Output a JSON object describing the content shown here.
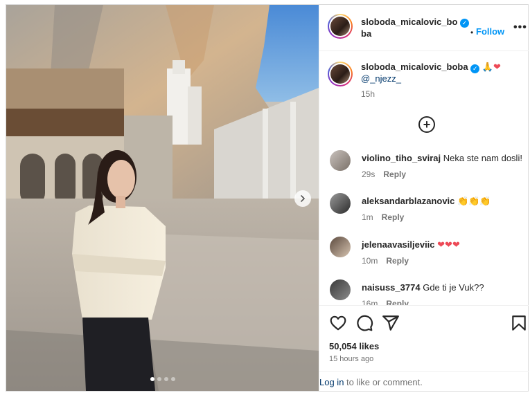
{
  "post": {
    "author": "sloboda_micalovic_boba",
    "follow_label": "Follow",
    "separator": "•",
    "more_label": "•••",
    "caption": {
      "username": "sloboda_micalovic_boba",
      "emojis": "🙏❤",
      "mention": "@_njezz_",
      "time": "15h"
    },
    "load_more_label": "+"
  },
  "photo": {
    "slide_count": 4,
    "active_slide": 1
  },
  "comments": [
    {
      "username": "violino_tiho_sviraj",
      "text": "Neka ste nam dosli!",
      "time": "29s",
      "reply_label": "Reply"
    },
    {
      "username": "aleksandarblazanovic",
      "text": "👏👏👏",
      "time": "1m",
      "reply_label": "Reply"
    },
    {
      "username": "jelenaavasiljeviic",
      "text": "❤❤❤",
      "time": "10m",
      "reply_label": "Reply"
    },
    {
      "username": "naisuss_3774",
      "text": "Gde ti je Vuk??",
      "time": "16m",
      "reply_label": "Reply"
    }
  ],
  "footer": {
    "likes": "50,054 likes",
    "posted": "15 hours ago",
    "login_link": "Log in",
    "login_rest": " to like or comment."
  },
  "icons": {
    "like": "heart-icon",
    "comment": "comment-icon",
    "share": "send-icon",
    "save": "bookmark-icon",
    "next": "chevron-right-icon",
    "options": "more-icon"
  },
  "colors": {
    "accent": "#0095f6",
    "heart": "#ed4956",
    "text": "#262626",
    "muted": "#737373",
    "link": "#00376b",
    "sky": "#5e9ad9"
  }
}
